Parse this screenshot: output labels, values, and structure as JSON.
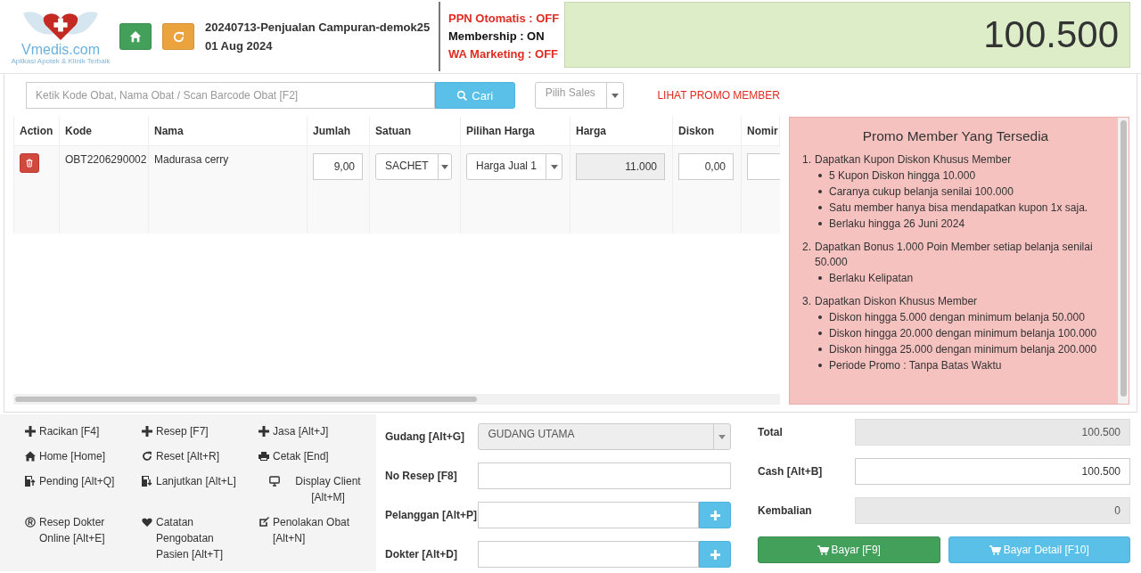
{
  "logo": {
    "name": "Vmedis.com",
    "tagline": "Aplikasi Apotek & Klinik Terbaik"
  },
  "header": {
    "title": "20240713-Penjualan Campuran-demok25",
    "date": "01 Aug 2024",
    "statuses": [
      {
        "text": "PPN Otomatis : OFF",
        "on": false
      },
      {
        "text": "Membership : ON",
        "on": true
      },
      {
        "text": "WA Marketing : OFF",
        "on": false
      }
    ],
    "grand_total": "100.500"
  },
  "search": {
    "placeholder": "Ketik Kode Obat, Nama Obat / Scan Barcode Obat [F2]",
    "button": "Cari"
  },
  "sales": {
    "placeholder": "Pilih Sales"
  },
  "promo_link": "LIHAT PROMO MEMBER",
  "table": {
    "columns": [
      "Action",
      "Kode",
      "Nama",
      "Jumlah",
      "Satuan",
      "Pilihan Harga",
      "Harga",
      "Diskon",
      "Nomir"
    ],
    "rows": [
      {
        "kode": "OBT2206290002",
        "nama": "Madurasa cerry",
        "jumlah": "9,00",
        "satuan": "SACHET",
        "pilihan_harga": "Harga Jual 1",
        "harga": "11.000",
        "diskon": "0,00"
      }
    ]
  },
  "promo": {
    "title": "Promo Member Yang Tersedia",
    "items": [
      {
        "number": "1.",
        "text": "Dapatkan Kupon Diskon Khusus Member",
        "children": [
          {
            "text": "5 Kupon Diskon hingga 10.000"
          },
          {
            "text": "Caranya cukup belanja senilai 100.000"
          },
          {
            "text": "Satu member hanya bisa mendapatkan kupon 1x saja."
          },
          {
            "text": "Berlaku hingga 26 Juni 2024"
          }
        ]
      },
      {
        "number": "2.",
        "text": "Dapatkan Bonus 1.000 Poin Member setiap belanja senilai 50.000",
        "children": [
          {
            "text": "Berlaku Kelipatan"
          }
        ]
      },
      {
        "number": "3.",
        "text": "Dapatkan Diskon Khusus Member",
        "children": [
          {
            "text": "Diskon hingga 5.000 dengan minimum belanja 50.000"
          },
          {
            "text": "Diskon hingga 20.000 dengan minimum belanja 100.000"
          },
          {
            "text": "Diskon hingga 25.000 dengan minimum belanja 200.000"
          },
          {
            "text": "Periode Promo : Tanpa Batas Waktu"
          }
        ]
      }
    ]
  },
  "shortcuts": [
    {
      "kind": "plus",
      "label": "Racikan [F4]"
    },
    {
      "kind": "plus",
      "label": "Resep [F7]"
    },
    {
      "kind": "plus",
      "label": "Jasa [Alt+J]"
    },
    {
      "kind": "home",
      "label": "Home [Home]"
    },
    {
      "kind": "reset",
      "label": "Reset [Alt+R]"
    },
    {
      "kind": "print",
      "label": "Cetak [End]"
    },
    {
      "kind": "pending",
      "label": "Pending [Alt+Q]"
    },
    {
      "kind": "resume",
      "label": "Lanjutkan [Alt+L]"
    },
    {
      "kind": "monitor",
      "label": "Display Client [Alt+M]"
    },
    {
      "kind": "registered",
      "label": "Resep Dokter Online [Alt+E]"
    },
    {
      "kind": "heart",
      "label": "Catatan Pengobatan Pasien [Alt+T]"
    },
    {
      "kind": "edit",
      "label": "Penolakan Obat [Alt+N]"
    }
  ],
  "fields": [
    {
      "kind": "select",
      "label": "Gudang [Alt+G]",
      "value": "GUDANG UTAMA",
      "disabled": true
    },
    {
      "kind": "input",
      "label": "No Resep [F8]"
    },
    {
      "kind": "add",
      "label": "Pelanggan [Alt+P]"
    },
    {
      "kind": "add",
      "label": "Dokter [Alt+D]"
    }
  ],
  "totals": [
    {
      "label": "Total",
      "value": "100.500",
      "readonly": true
    },
    {
      "label": "Cash [Alt+B]",
      "value": "100.500",
      "readonly": false
    },
    {
      "label": "Kembalian",
      "value": "0",
      "readonly": true
    }
  ],
  "pay_buttons": [
    {
      "kind": "primary",
      "label": "Bayar [F9]"
    },
    {
      "kind": "info",
      "label": "Bayar Detail [F10]"
    }
  ]
}
